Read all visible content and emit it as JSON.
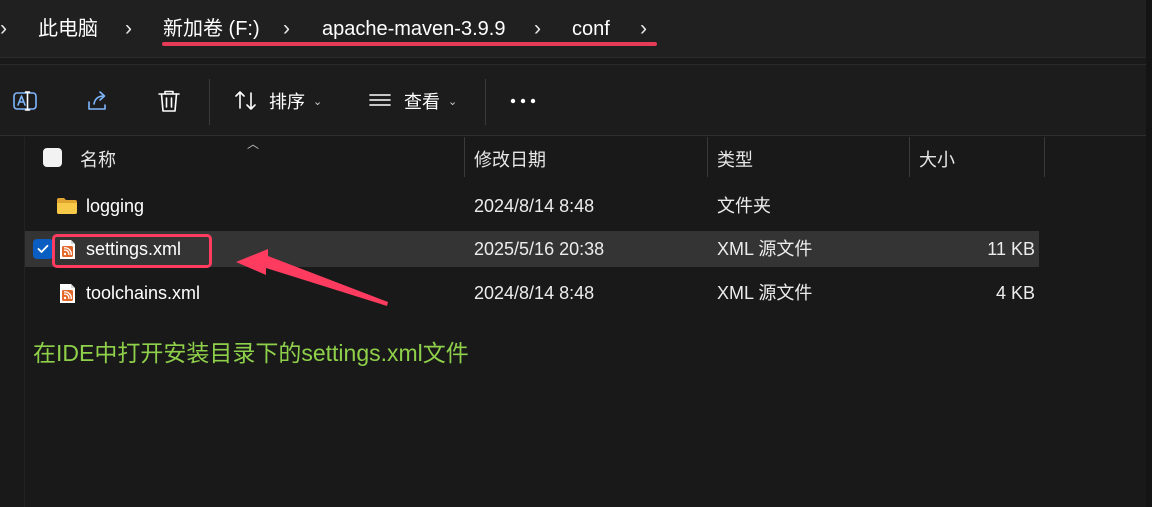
{
  "breadcrumb": {
    "items": [
      "此电脑",
      "新加卷 (F:)",
      "apache-maven-3.9.9",
      "conf"
    ]
  },
  "toolbar": {
    "sort_label": "排序",
    "view_label": "查看",
    "icons": [
      "rename-icon",
      "share-icon",
      "delete-icon",
      "sort-icon",
      "view-icon",
      "more-icon"
    ]
  },
  "columns": {
    "name": "名称",
    "modified": "修改日期",
    "type": "类型",
    "size": "大小"
  },
  "files": [
    {
      "name": "logging",
      "modified": "2024/8/14 8:48",
      "type": "文件夹",
      "size": "",
      "icon": "folder-icon",
      "selected": false
    },
    {
      "name": "settings.xml",
      "modified": "2025/5/16 20:38",
      "type": "XML 源文件",
      "size": "11 KB",
      "icon": "xml-file-icon",
      "selected": true
    },
    {
      "name": "toolchains.xml",
      "modified": "2024/8/14 8:48",
      "type": "XML 源文件",
      "size": "4 KB",
      "icon": "xml-file-icon",
      "selected": false
    }
  ],
  "annotation": {
    "text": "在IDE中打开安装目录下的settings.xml文件",
    "color": "#8fd04a",
    "highlight_color": "#ff3c5f"
  },
  "colors": {
    "background": "#191919",
    "selection_row": "#343434",
    "check_accent": "#0a5ec2",
    "folder": "#f2c14e",
    "xml_icon": "#e4672a"
  }
}
